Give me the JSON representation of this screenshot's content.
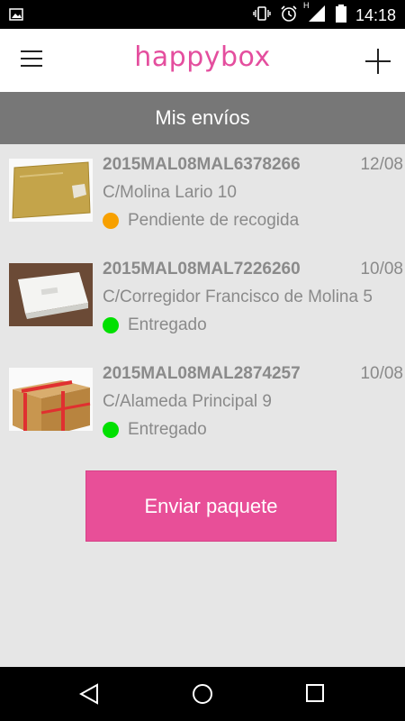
{
  "status_bar": {
    "time": "14:18",
    "icons": [
      "image-icon",
      "vibrate-icon",
      "alarm-icon",
      "signal-h-icon",
      "signal-icon",
      "battery-icon"
    ],
    "network_label": "H"
  },
  "app_bar": {
    "logo_text": "happybox",
    "menu_icon": "hamburger-menu-icon",
    "add_icon": "plus-icon",
    "logo_color": "#e44e9e"
  },
  "section": {
    "title": "Mis envíos"
  },
  "shipments": [
    {
      "code": "2015MAL08MAL6378266",
      "date": "12/08",
      "address": "C/Molina Lario 10",
      "status": "Pendiente de recogida",
      "status_color": "#f7a000",
      "thumb": "padded-envelope"
    },
    {
      "code": "2015MAL08MAL7226260",
      "date": "10/08",
      "address": "C/Corregidor Francisco de Molina 5",
      "status": "Entregado",
      "status_color": "#00e000",
      "thumb": "white-box"
    },
    {
      "code": "2015MAL08MAL2874257",
      "date": "10/08",
      "address": "C/Alameda Principal 9",
      "status": "Entregado",
      "status_color": "#00e000",
      "thumb": "fragile-cardboard-box"
    }
  ],
  "send_button": {
    "label": "Enviar paquete",
    "color": "#e84f98"
  },
  "nav_bar": {
    "back_icon": "back-triangle-icon",
    "home_icon": "home-circle-icon",
    "recents_icon": "recents-square-icon"
  }
}
